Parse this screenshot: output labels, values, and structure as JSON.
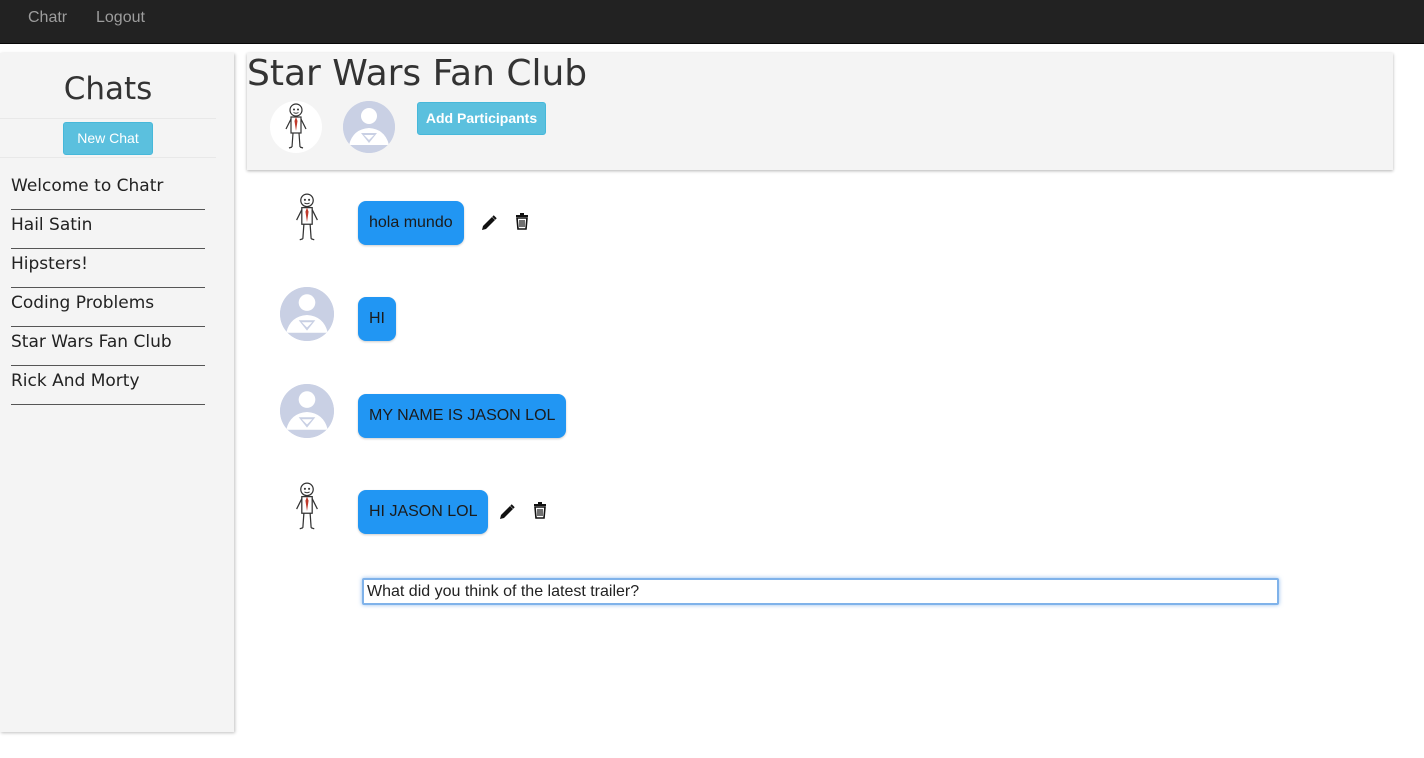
{
  "navbar": {
    "brand": "Chatr",
    "logout": "Logout"
  },
  "sidebar": {
    "title": "Chats",
    "new_chat_label": "New Chat",
    "chats": [
      {
        "label": "Welcome to Chatr"
      },
      {
        "label": "Hail Satin"
      },
      {
        "label": "Hipsters!"
      },
      {
        "label": "Coding Problems"
      },
      {
        "label": "Star Wars Fan Club"
      },
      {
        "label": "Rick And Morty"
      }
    ]
  },
  "chat": {
    "title": "Star Wars Fan Club",
    "add_participants_label": "Add Participants",
    "participants": [
      {
        "avatar": "stick-figure-avatar"
      },
      {
        "avatar": "superman-avatar"
      }
    ],
    "messages": [
      {
        "text": "hola mundo",
        "avatar": "stick-figure-avatar",
        "editable": true
      },
      {
        "text": "HI",
        "avatar": "superman-avatar",
        "editable": false
      },
      {
        "text": "MY NAME IS JASON LOL",
        "avatar": "superman-avatar",
        "editable": false
      },
      {
        "text": "HI JASON LOL",
        "avatar": "stick-figure-avatar",
        "editable": true
      }
    ]
  },
  "composer": {
    "value": "What did you think of the latest trailer?"
  },
  "colors": {
    "accent": "#5bc0de",
    "bubble": "#2196f3",
    "navbar": "#222222",
    "panel": "#f4f4f4"
  },
  "icons": {
    "edit": "pencil-icon",
    "delete": "trash-icon"
  }
}
